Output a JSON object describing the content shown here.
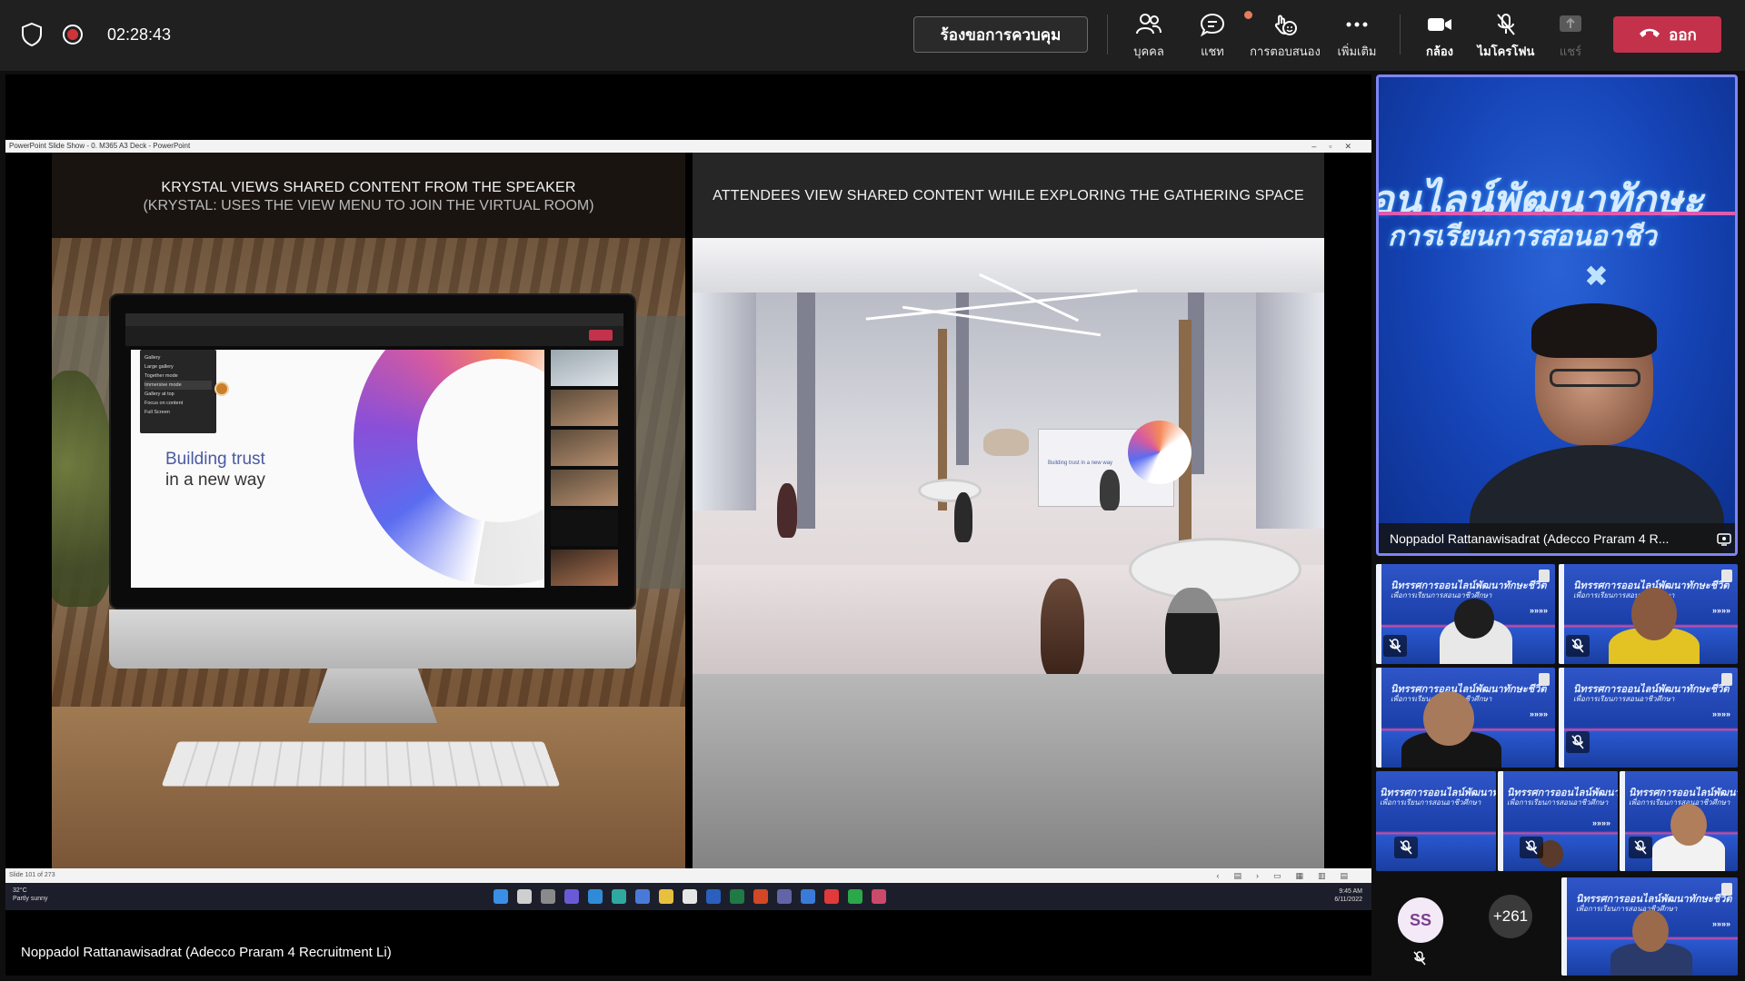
{
  "topbar": {
    "timer": "02:28:43",
    "request_control_label": "ร้องขอการควบคุม",
    "tools": [
      {
        "label": "บุคคล"
      },
      {
        "label": "แชท"
      },
      {
        "label": "การตอบสนอง"
      },
      {
        "label": "เพิ่มเติม"
      },
      {
        "label": "กล้อง"
      },
      {
        "label": "ไมโครโฟน"
      },
      {
        "label": "แชร์"
      }
    ],
    "leave_label": "ออก",
    "colors": {
      "leave": "#c4314b",
      "active_border": "#7f85f5"
    }
  },
  "stage": {
    "ppt_title": "PowerPoint Slide Show - 0. M365 A3 Deck - PowerPoint",
    "slide": {
      "left_title": "KRYSTAL VIEWS SHARED CONTENT FROM THE SPEAKER",
      "left_subtitle": "(KRYSTAL:  USES THE VIEW MENU TO JOIN THE VIRTUAL ROOM)",
      "right_title": "ATTENDEES VIEW SHARED CONTENT WHILE EXPLORING THE GATHERING SPACE",
      "shared_line1": "Building trust",
      "shared_line2": "in a new way",
      "screen_text": "Building trust in a new way",
      "view_menu": [
        "Gallery",
        "Large gallery",
        "Together mode",
        "Immersive mode",
        "Gallery at top",
        "Focus on content",
        "Full Screen"
      ]
    },
    "ppt_status": "Slide 101 of 273",
    "taskbar": {
      "weather_temp": "32°C",
      "weather_desc": "Partly sunny",
      "time": "9:45 AM",
      "date": "6/11/2022"
    },
    "presenter_name": "Noppadol Rattanawisadrat (Adecco Praram 4 Recruitment Li)"
  },
  "speaker": {
    "name": "Noppadol Rattanawisadrat (Adecco Praram 4 R...",
    "banner_line1": "อนไลน์พัฒนาทักษะ",
    "banner_line2": "การเรียนการสอนอาชีว"
  },
  "participants": {
    "tile_banner_line1": "นิทรรศการออนไลน์พัฒนาทักษะชีวิต",
    "tile_banner_line2": "เพื่อการเรียนการสอนอาชีวศึกษา",
    "chevrons": "»»»»",
    "ss_initials": "SS",
    "more_count": "+261"
  }
}
